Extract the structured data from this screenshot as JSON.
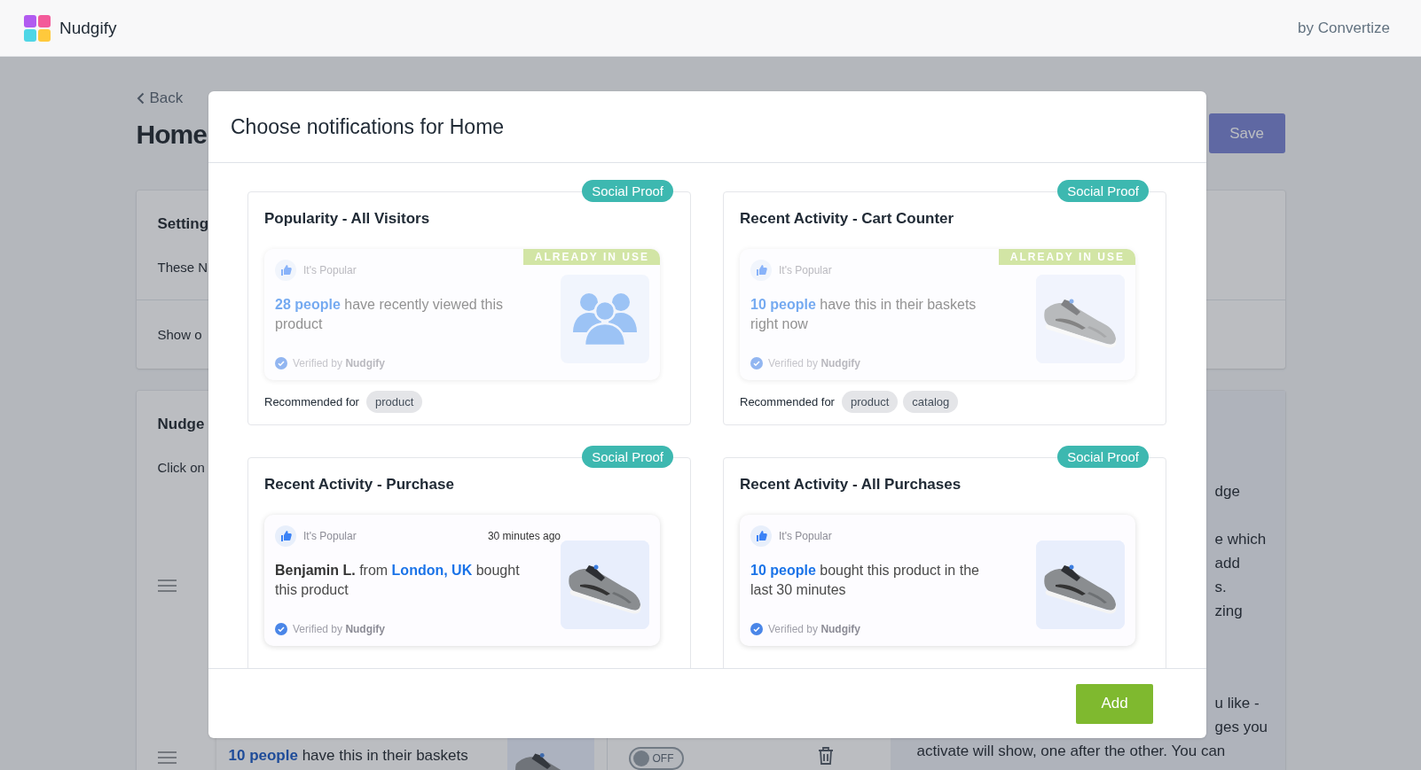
{
  "navbar": {
    "brand": "Nudgify",
    "byline": "by Convertize"
  },
  "page": {
    "back": "Back",
    "title": "Home",
    "save": "Save",
    "settings_card": {
      "title": "Setting",
      "text": "These N",
      "row": "Show o"
    },
    "nudges_card": {
      "title": "Nudge",
      "text": "Click on",
      "help_paragraphs": [
        [
          "dge"
        ],
        [
          "e which",
          "add",
          "s.",
          "zing"
        ],
        [
          "u like -",
          "ges you"
        ]
      ],
      "help_last_line": "activate will show, one after the other. You can",
      "row": {
        "message": "**10 people** have this in their baskets",
        "toggle": {
          "label": "OFF",
          "on": false
        }
      }
    }
  },
  "modal": {
    "title": "Choose notifications for Home",
    "notifications": [
      {
        "title": "Popularity - All Visitors",
        "category": "Social Proof",
        "in_use": true,
        "in_use_label": "ALREADY IN USE",
        "header": "It's Popular",
        "message": [
          {
            "text": "28 people",
            "kind": "highlight"
          },
          {
            "text": " have recently viewed this product",
            "kind": "plain"
          }
        ],
        "verified": "Verified by **Nudgify**",
        "media": {
          "kind": "icon"
        },
        "recommended_label": "Recommended for",
        "tags": [
          "product"
        ]
      },
      {
        "title": "Recent Activity - Cart Counter",
        "category": "Social Proof",
        "in_use": true,
        "in_use_label": "ALREADY IN USE",
        "header": "It's Popular",
        "message": [
          {
            "text": "10 people",
            "kind": "highlight"
          },
          {
            "text": " have this in their baskets right now",
            "kind": "plain"
          }
        ],
        "verified": "Verified by **Nudgify**",
        "media": {
          "kind": "picture"
        },
        "recommended_label": "Recommended for",
        "tags": [
          "product",
          "catalog"
        ]
      },
      {
        "title": "Recent Activity - Purchase",
        "category": "Social Proof",
        "in_use": false,
        "header": "It's Popular",
        "time": "30 minutes ago",
        "message": [
          {
            "text": "Benjamin L.",
            "kind": "name"
          },
          {
            "text": " from ",
            "kind": "plain"
          },
          {
            "text": "London, UK",
            "kind": "highlight"
          },
          {
            "text": " bought this product",
            "kind": "plain"
          }
        ],
        "verified": "Verified by **Nudgify**",
        "media": {
          "kind": "picture"
        }
      },
      {
        "title": "Recent Activity - All Purchases",
        "category": "Social Proof",
        "in_use": false,
        "header": "It's Popular",
        "message": [
          {
            "text": "10 people",
            "kind": "highlight"
          },
          {
            "text": " bought this product in the last 30 minutes",
            "kind": "plain"
          }
        ],
        "verified": "Verified by **Nudgify**",
        "media": {
          "kind": "picture"
        }
      }
    ],
    "add_button": "Add"
  }
}
